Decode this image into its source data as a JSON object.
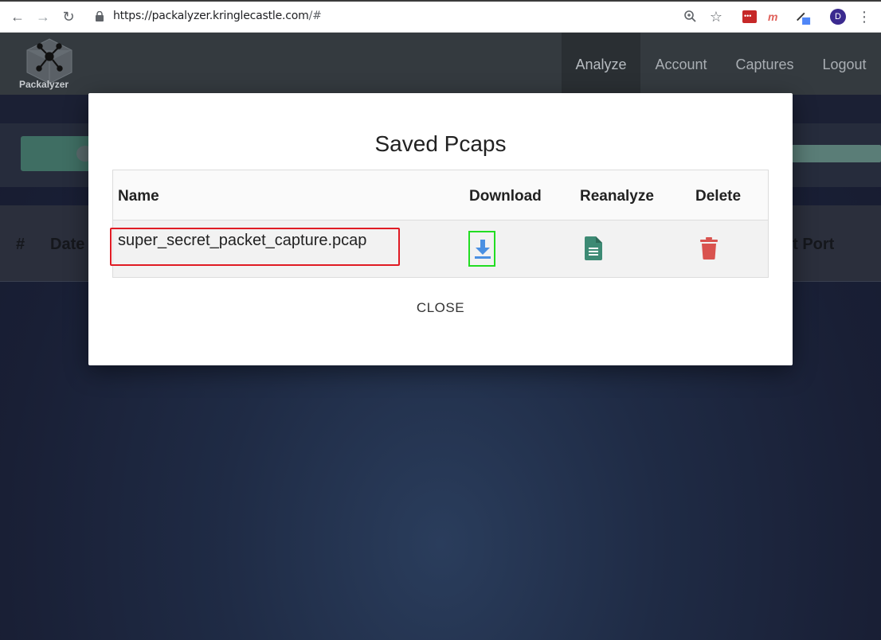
{
  "browser": {
    "url_host": "https://packalyzer.kringlecastle.com",
    "url_path": "/#",
    "profile_initial": "D"
  },
  "app": {
    "logo_text": "Packalyzer",
    "nav": [
      {
        "label": "Analyze",
        "active": true
      },
      {
        "label": "Account",
        "active": false
      },
      {
        "label": "Captures",
        "active": false
      },
      {
        "label": "Logout",
        "active": false
      }
    ]
  },
  "background_table": {
    "col_hash": "#",
    "col_date": "Date",
    "col_port": "st Port"
  },
  "modal": {
    "title": "Saved Pcaps",
    "columns": {
      "name": "Name",
      "download": "Download",
      "reanalyze": "Reanalyze",
      "delete": "Delete"
    },
    "rows": [
      {
        "name": "super_secret_packet_capture.pcap"
      }
    ],
    "close_label": "CLOSE"
  },
  "colors": {
    "header_bg": "#343a3f",
    "download_icon": "#4a90e2",
    "reanalyze_icon": "#3d8a74",
    "delete_icon": "#d9534f",
    "filename_highlight": "#e01b24",
    "download_highlight": "#22dd22"
  }
}
